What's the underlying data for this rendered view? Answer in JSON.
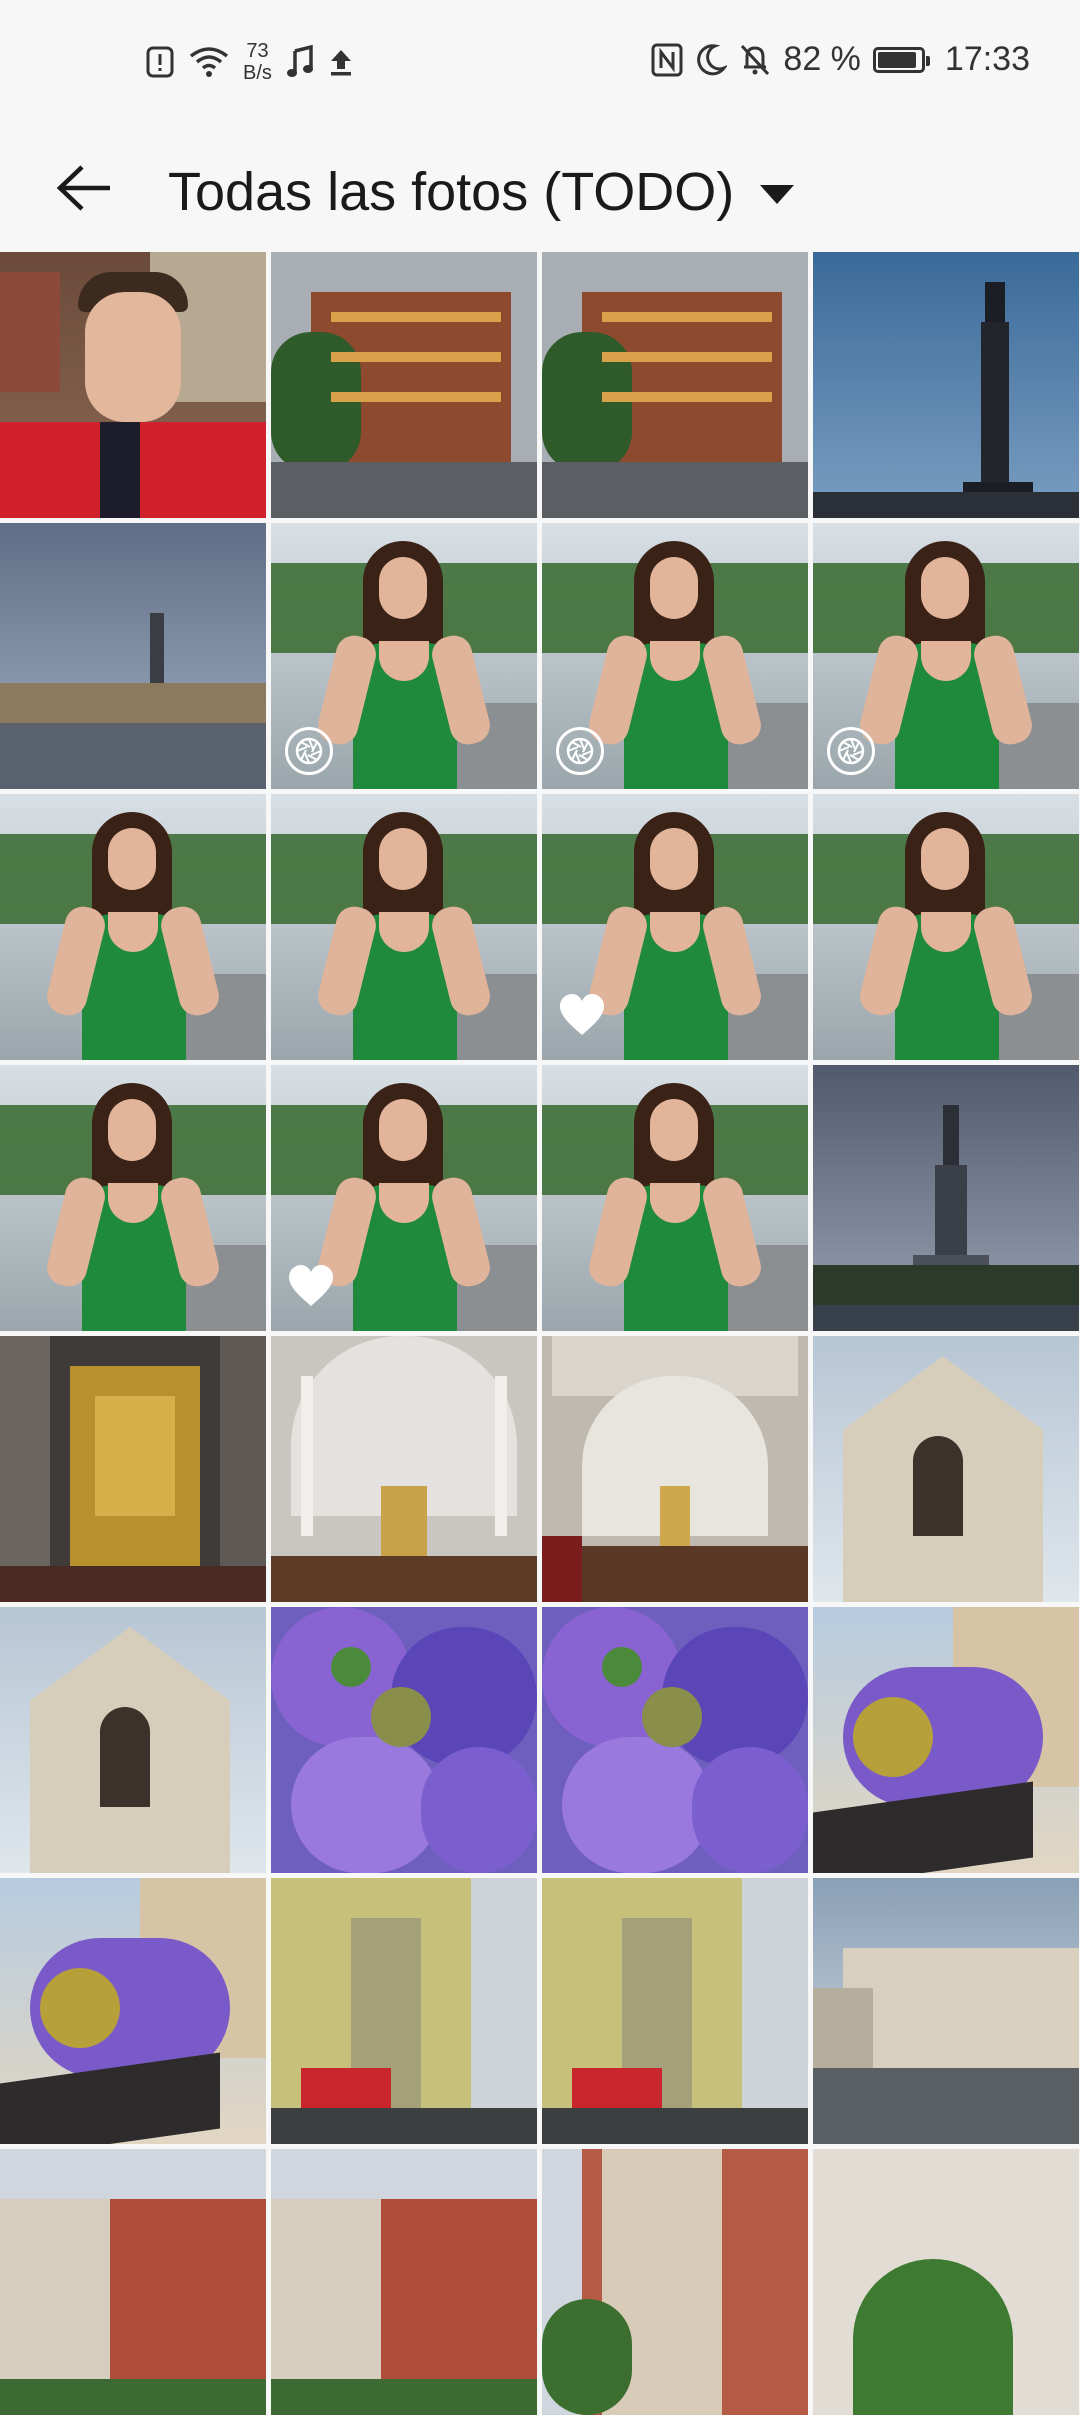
{
  "status_bar": {
    "net_speed_value": "73",
    "net_speed_unit": "B/s",
    "battery_percent": "82 %",
    "time": "17:33",
    "icons": [
      "alert-icon",
      "wifi-icon",
      "music-note-icon",
      "upload-icon",
      "nfc-icon",
      "moon-icon",
      "mute-bell-icon",
      "battery-charging-icon"
    ]
  },
  "header": {
    "title": "Todas las fotos (TODO)",
    "back_icon": "arrow-left-icon",
    "dropdown_icon": "caret-down-icon"
  },
  "photos": [
    {
      "subject": "selfie-man-red-shirt",
      "badge": ""
    },
    {
      "subject": "brick-building-street",
      "badge": ""
    },
    {
      "subject": "brick-building-street",
      "badge": ""
    },
    {
      "subject": "column-statue-blue-sky",
      "badge": ""
    },
    {
      "subject": "plaza-column-cloudy",
      "badge": ""
    },
    {
      "subject": "woman-green-dress",
      "badge": "aperture-icon"
    },
    {
      "subject": "woman-green-dress",
      "badge": "aperture-icon"
    },
    {
      "subject": "woman-green-dress",
      "badge": "aperture-icon"
    },
    {
      "subject": "woman-green-dress",
      "badge": ""
    },
    {
      "subject": "woman-green-dress",
      "badge": ""
    },
    {
      "subject": "woman-green-dress",
      "badge": "heart-icon"
    },
    {
      "subject": "woman-green-dress",
      "badge": ""
    },
    {
      "subject": "woman-green-dress",
      "badge": ""
    },
    {
      "subject": "woman-green-dress",
      "badge": "heart-icon"
    },
    {
      "subject": "woman-green-dress",
      "badge": ""
    },
    {
      "subject": "column-monument-dusk",
      "badge": ""
    },
    {
      "subject": "church-golden-altar",
      "badge": ""
    },
    {
      "subject": "church-white-nave",
      "badge": ""
    },
    {
      "subject": "church-nave-pews",
      "badge": ""
    },
    {
      "subject": "gothic-church-facade",
      "badge": ""
    },
    {
      "subject": "gothic-church-facade",
      "badge": ""
    },
    {
      "subject": "purple-hydrangeas",
      "badge": ""
    },
    {
      "subject": "purple-hydrangeas",
      "badge": ""
    },
    {
      "subject": "balcony-flower-box",
      "badge": ""
    },
    {
      "subject": "balcony-flower-box",
      "badge": ""
    },
    {
      "subject": "yellow-building-red-bank",
      "badge": ""
    },
    {
      "subject": "yellow-building-red-bank",
      "badge": ""
    },
    {
      "subject": "white-building-avenue",
      "badge": ""
    },
    {
      "subject": "red-brick-buildings",
      "badge": ""
    },
    {
      "subject": "red-brick-buildings",
      "badge": ""
    },
    {
      "subject": "red-brick-buildings-trees",
      "badge": ""
    },
    {
      "subject": "white-building-tree",
      "badge": ""
    }
  ],
  "colors": {
    "background": "#f7f7f7",
    "text": "#1a1a1a",
    "badge_white": "#ffffff"
  }
}
